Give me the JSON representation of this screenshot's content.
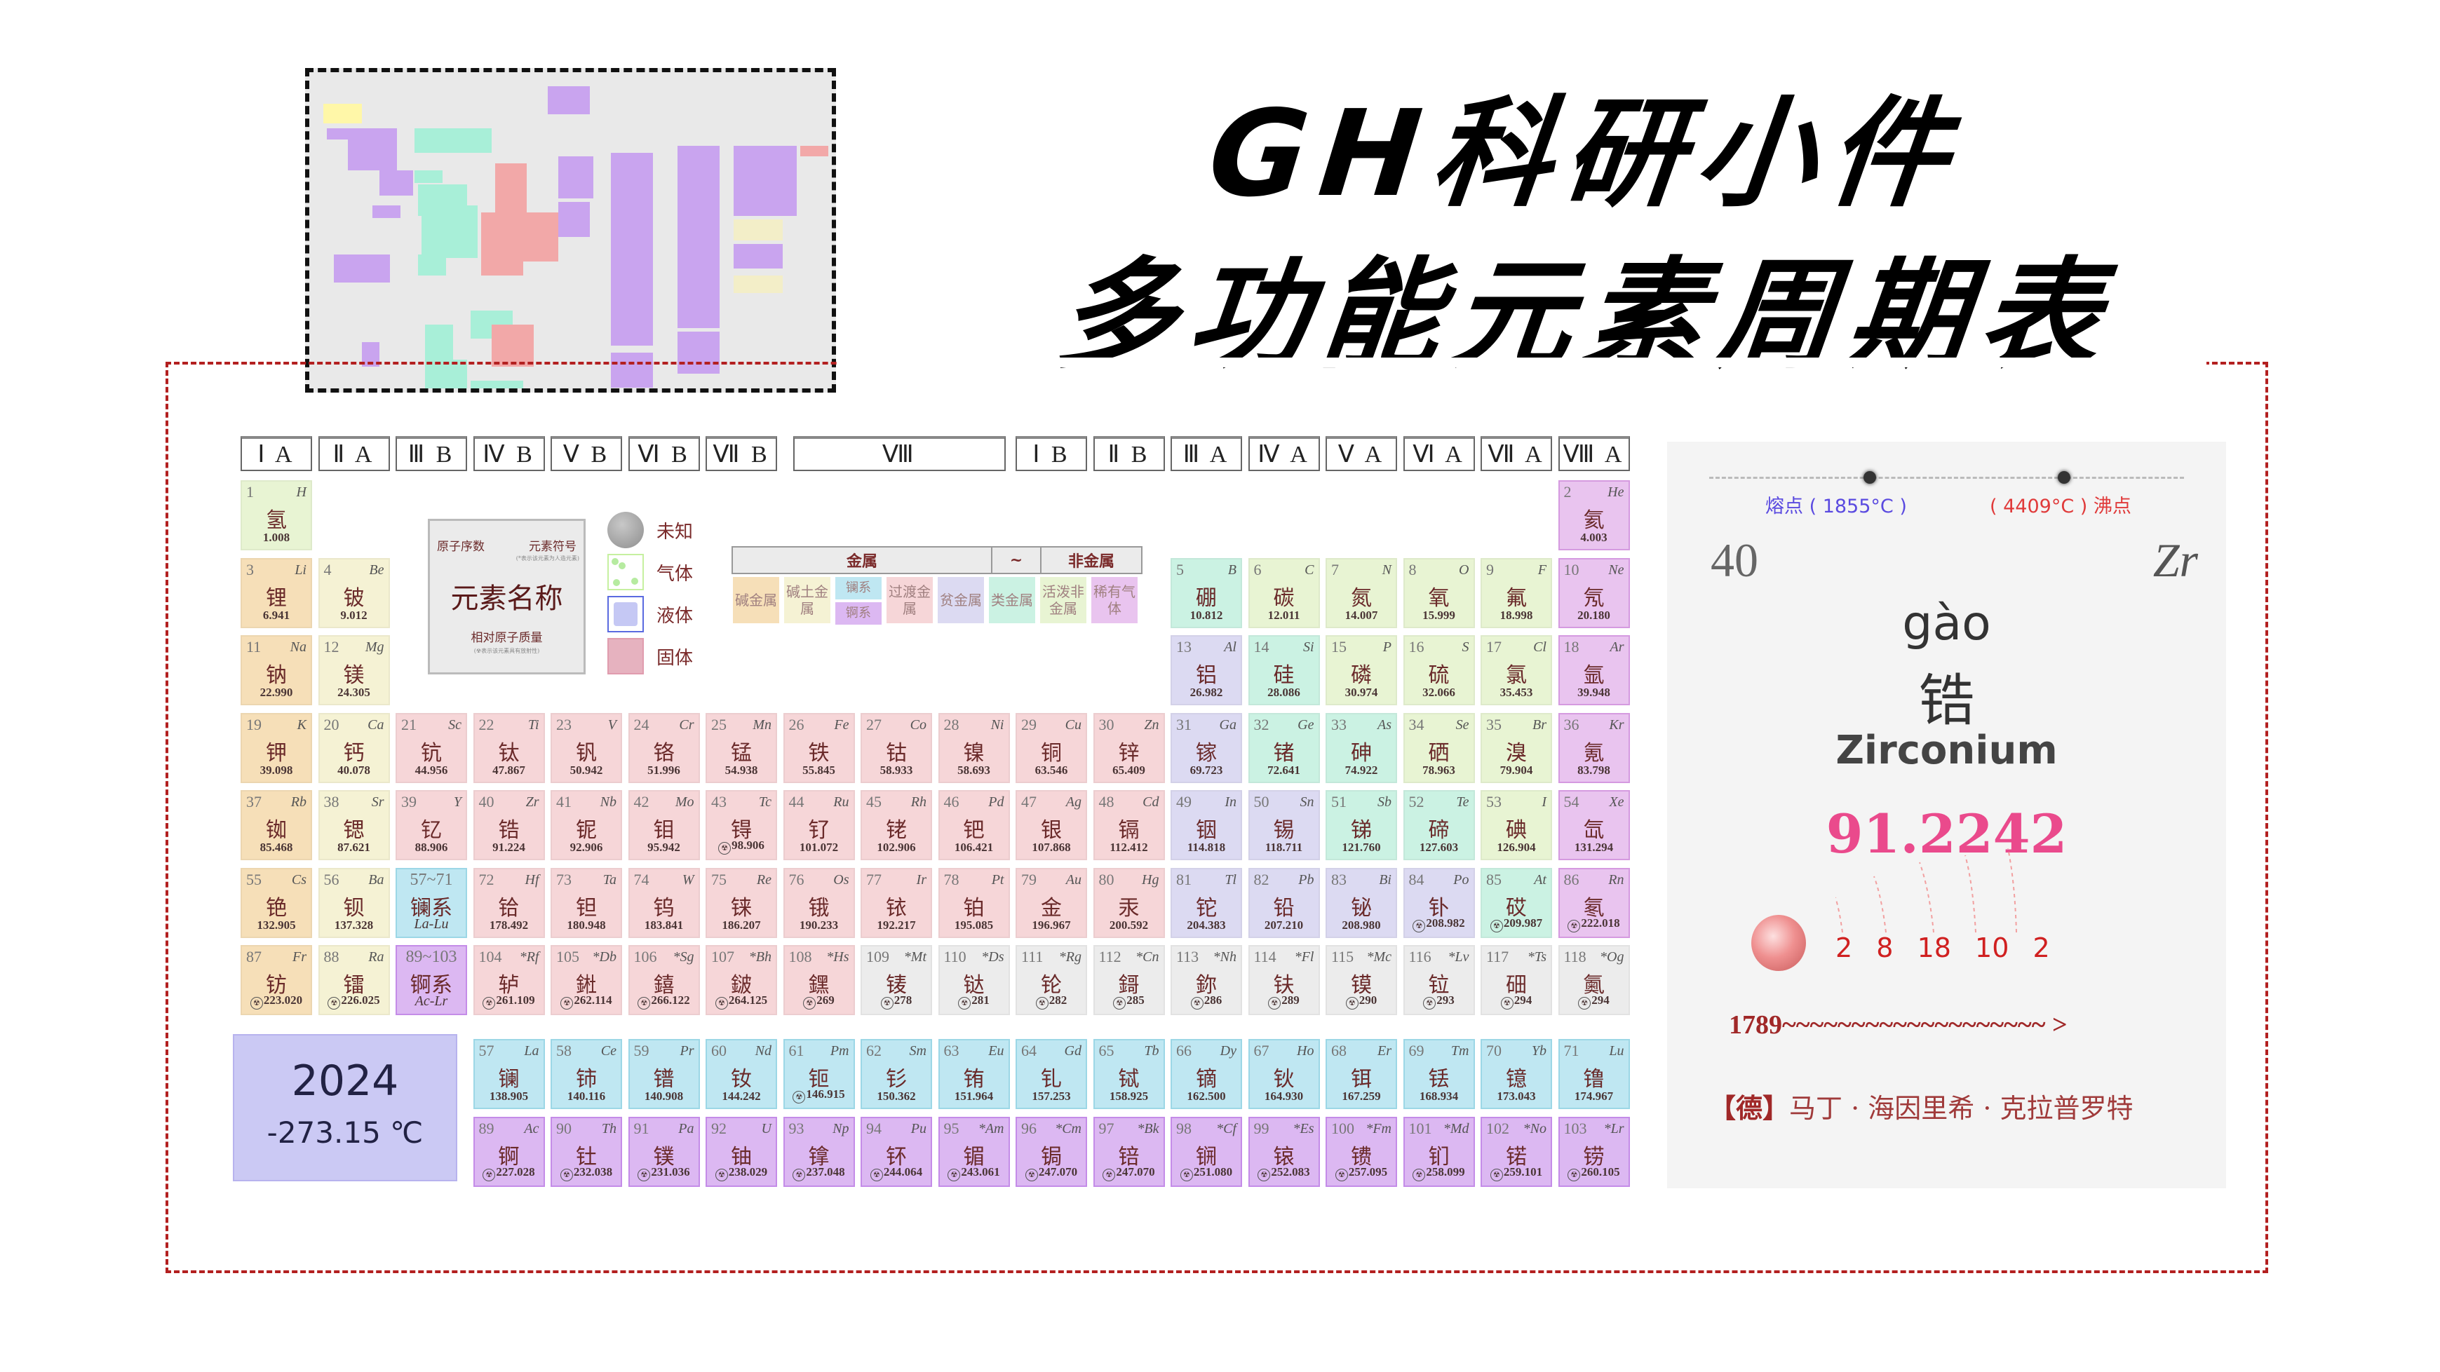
{
  "header": {
    "title_line1": "GH科研小件",
    "title_line2": "多功能元素周期表"
  },
  "groups": [
    "Ⅰ A",
    "Ⅱ A",
    "Ⅲ B",
    "Ⅳ B",
    "Ⅴ B",
    "Ⅵ B",
    "Ⅶ B",
    "Ⅷ",
    "Ⅰ B",
    "Ⅱ B",
    "Ⅲ A",
    "Ⅳ A",
    "Ⅴ A",
    "Ⅵ A",
    "Ⅶ A",
    "Ⅷ A"
  ],
  "legend": {
    "top_left": "原子序数",
    "top_right": "元素符号",
    "top_note": "(*表示该元素为人造元素)",
    "center": "元素名称",
    "bottom": "相对原子质量",
    "bottom_note": "(☢表示该元素具有放射性)",
    "states": [
      {
        "label": "未知",
        "icon": "unknown-state-icon"
      },
      {
        "label": "气体",
        "icon": "gas-state-icon"
      },
      {
        "label": "液体",
        "icon": "liquid-state-icon"
      },
      {
        "label": "固体",
        "icon": "solid-state-icon"
      }
    ],
    "category_heads": [
      "金属",
      "~",
      "非金属"
    ],
    "categories": [
      "碱金属",
      "碱土金属",
      "镧系",
      "锕系",
      "过渡金属",
      "贫金属",
      "类金属",
      "活泼非金属",
      "稀有气体"
    ]
  },
  "info": {
    "year": "2024",
    "temperature": "-273.15 ℃"
  },
  "detail": {
    "melting_point": "熔点 ( 1855°C )",
    "boiling_point": "( 4409°C ) 沸点",
    "number": "40",
    "symbol": "Zr",
    "pinyin": "gào",
    "chinese": "锆",
    "english": "Zirconium",
    "mass": "91.2242",
    "shells": [
      "2",
      "8",
      "18",
      "10",
      "2"
    ],
    "discovery": "1789~~~~~~~~~~~~~~~~~~~ >",
    "discoverer_country": "【德】",
    "discoverer": "马丁 · 海因里希 · 克拉普罗特"
  },
  "elements": [
    {
      "n": "1",
      "s": "H",
      "c": "氢",
      "m": "1.008",
      "cat": "nonmetal",
      "row": 1,
      "col": 1
    },
    {
      "n": "2",
      "s": "He",
      "c": "氦",
      "m": "4.003",
      "cat": "noble",
      "row": 1,
      "col": 18
    },
    {
      "n": "3",
      "s": "Li",
      "c": "锂",
      "m": "6.941",
      "cat": "alkali",
      "row": 2,
      "col": 1
    },
    {
      "n": "4",
      "s": "Be",
      "c": "铍",
      "m": "9.012",
      "cat": "alkearth",
      "row": 2,
      "col": 2
    },
    {
      "n": "5",
      "s": "B",
      "c": "硼",
      "m": "10.812",
      "cat": "metalloid",
      "row": 2,
      "col": 13
    },
    {
      "n": "6",
      "s": "C",
      "c": "碳",
      "m": "12.011",
      "cat": "nonmetal",
      "row": 2,
      "col": 14
    },
    {
      "n": "7",
      "s": "N",
      "c": "氮",
      "m": "14.007",
      "cat": "nonmetal",
      "row": 2,
      "col": 15
    },
    {
      "n": "8",
      "s": "O",
      "c": "氧",
      "m": "15.999",
      "cat": "nonmetal",
      "row": 2,
      "col": 16
    },
    {
      "n": "9",
      "s": "F",
      "c": "氟",
      "m": "18.998",
      "cat": "nonmetal",
      "row": 2,
      "col": 17
    },
    {
      "n": "10",
      "s": "Ne",
      "c": "氖",
      "m": "20.180",
      "cat": "noble",
      "row": 2,
      "col": 18
    },
    {
      "n": "11",
      "s": "Na",
      "c": "钠",
      "m": "22.990",
      "cat": "alkali",
      "row": 3,
      "col": 1
    },
    {
      "n": "12",
      "s": "Mg",
      "c": "镁",
      "m": "24.305",
      "cat": "alkearth",
      "row": 3,
      "col": 2
    },
    {
      "n": "13",
      "s": "Al",
      "c": "铝",
      "m": "26.982",
      "cat": "poor",
      "row": 3,
      "col": 13
    },
    {
      "n": "14",
      "s": "Si",
      "c": "硅",
      "m": "28.086",
      "cat": "metalloid",
      "row": 3,
      "col": 14
    },
    {
      "n": "15",
      "s": "P",
      "c": "磷",
      "m": "30.974",
      "cat": "nonmetal",
      "row": 3,
      "col": 15
    },
    {
      "n": "16",
      "s": "S",
      "c": "硫",
      "m": "32.066",
      "cat": "nonmetal",
      "row": 3,
      "col": 16
    },
    {
      "n": "17",
      "s": "Cl",
      "c": "氯",
      "m": "35.453",
      "cat": "nonmetal",
      "row": 3,
      "col": 17
    },
    {
      "n": "18",
      "s": "Ar",
      "c": "氩",
      "m": "39.948",
      "cat": "noble",
      "row": 3,
      "col": 18
    },
    {
      "n": "19",
      "s": "K",
      "c": "钾",
      "m": "39.098",
      "cat": "alkali",
      "row": 4,
      "col": 1
    },
    {
      "n": "20",
      "s": "Ca",
      "c": "钙",
      "m": "40.078",
      "cat": "alkearth",
      "row": 4,
      "col": 2
    },
    {
      "n": "21",
      "s": "Sc",
      "c": "钪",
      "m": "44.956",
      "cat": "trans",
      "row": 4,
      "col": 3
    },
    {
      "n": "22",
      "s": "Ti",
      "c": "钛",
      "m": "47.867",
      "cat": "trans",
      "row": 4,
      "col": 4
    },
    {
      "n": "23",
      "s": "V",
      "c": "钒",
      "m": "50.942",
      "cat": "trans",
      "row": 4,
      "col": 5
    },
    {
      "n": "24",
      "s": "Cr",
      "c": "铬",
      "m": "51.996",
      "cat": "trans",
      "row": 4,
      "col": 6
    },
    {
      "n": "25",
      "s": "Mn",
      "c": "锰",
      "m": "54.938",
      "cat": "trans",
      "row": 4,
      "col": 7
    },
    {
      "n": "26",
      "s": "Fe",
      "c": "铁",
      "m": "55.845",
      "cat": "trans",
      "row": 4,
      "col": 8
    },
    {
      "n": "27",
      "s": "Co",
      "c": "钴",
      "m": "58.933",
      "cat": "trans",
      "row": 4,
      "col": 9
    },
    {
      "n": "28",
      "s": "Ni",
      "c": "镍",
      "m": "58.693",
      "cat": "trans",
      "row": 4,
      "col": 10
    },
    {
      "n": "29",
      "s": "Cu",
      "c": "铜",
      "m": "63.546",
      "cat": "trans",
      "row": 4,
      "col": 11
    },
    {
      "n": "30",
      "s": "Zn",
      "c": "锌",
      "m": "65.409",
      "cat": "trans",
      "row": 4,
      "col": 12
    },
    {
      "n": "31",
      "s": "Ga",
      "c": "镓",
      "m": "69.723",
      "cat": "poor",
      "row": 4,
      "col": 13
    },
    {
      "n": "32",
      "s": "Ge",
      "c": "锗",
      "m": "72.641",
      "cat": "metalloid",
      "row": 4,
      "col": 14
    },
    {
      "n": "33",
      "s": "As",
      "c": "砷",
      "m": "74.922",
      "cat": "metalloid",
      "row": 4,
      "col": 15
    },
    {
      "n": "34",
      "s": "Se",
      "c": "硒",
      "m": "78.963",
      "cat": "nonmetal",
      "row": 4,
      "col": 16
    },
    {
      "n": "35",
      "s": "Br",
      "c": "溴",
      "m": "79.904",
      "cat": "nonmetal",
      "row": 4,
      "col": 17
    },
    {
      "n": "36",
      "s": "Kr",
      "c": "氪",
      "m": "83.798",
      "cat": "noble",
      "row": 4,
      "col": 18
    },
    {
      "n": "37",
      "s": "Rb",
      "c": "铷",
      "m": "85.468",
      "cat": "alkali",
      "row": 5,
      "col": 1
    },
    {
      "n": "38",
      "s": "Sr",
      "c": "锶",
      "m": "87.621",
      "cat": "alkearth",
      "row": 5,
      "col": 2
    },
    {
      "n": "39",
      "s": "Y",
      "c": "钇",
      "m": "88.906",
      "cat": "trans",
      "row": 5,
      "col": 3
    },
    {
      "n": "40",
      "s": "Zr",
      "c": "锆",
      "m": "91.224",
      "cat": "trans",
      "row": 5,
      "col": 4
    },
    {
      "n": "41",
      "s": "Nb",
      "c": "铌",
      "m": "92.906",
      "cat": "trans",
      "row": 5,
      "col": 5
    },
    {
      "n": "42",
      "s": "Mo",
      "c": "钼",
      "m": "95.942",
      "cat": "trans",
      "row": 5,
      "col": 6
    },
    {
      "n": "43",
      "s": "Tc",
      "c": "锝",
      "m": "98.906",
      "r": true,
      "cat": "trans",
      "row": 5,
      "col": 7
    },
    {
      "n": "44",
      "s": "Ru",
      "c": "钌",
      "m": "101.072",
      "cat": "trans",
      "row": 5,
      "col": 8
    },
    {
      "n": "45",
      "s": "Rh",
      "c": "铑",
      "m": "102.906",
      "cat": "trans",
      "row": 5,
      "col": 9
    },
    {
      "n": "46",
      "s": "Pd",
      "c": "钯",
      "m": "106.421",
      "cat": "trans",
      "row": 5,
      "col": 10
    },
    {
      "n": "47",
      "s": "Ag",
      "c": "银",
      "m": "107.868",
      "cat": "trans",
      "row": 5,
      "col": 11
    },
    {
      "n": "48",
      "s": "Cd",
      "c": "镉",
      "m": "112.412",
      "cat": "trans",
      "row": 5,
      "col": 12
    },
    {
      "n": "49",
      "s": "In",
      "c": "铟",
      "m": "114.818",
      "cat": "poor",
      "row": 5,
      "col": 13
    },
    {
      "n": "50",
      "s": "Sn",
      "c": "锡",
      "m": "118.711",
      "cat": "poor",
      "row": 5,
      "col": 14
    },
    {
      "n": "51",
      "s": "Sb",
      "c": "锑",
      "m": "121.760",
      "cat": "metalloid",
      "row": 5,
      "col": 15
    },
    {
      "n": "52",
      "s": "Te",
      "c": "碲",
      "m": "127.603",
      "cat": "metalloid",
      "row": 5,
      "col": 16
    },
    {
      "n": "53",
      "s": "I",
      "c": "碘",
      "m": "126.904",
      "cat": "nonmetal",
      "row": 5,
      "col": 17
    },
    {
      "n": "54",
      "s": "Xe",
      "c": "氙",
      "m": "131.294",
      "cat": "noble",
      "row": 5,
      "col": 18
    },
    {
      "n": "55",
      "s": "Cs",
      "c": "铯",
      "m": "132.905",
      "cat": "alkali",
      "row": 6,
      "col": 1
    },
    {
      "n": "56",
      "s": "Ba",
      "c": "钡",
      "m": "137.328",
      "cat": "alkearth",
      "row": 6,
      "col": 2
    },
    {
      "n": "57~71",
      "s": "",
      "c": "镧系",
      "m": "La-Lu",
      "it": true,
      "cat": "lanth",
      "row": 6,
      "col": 3
    },
    {
      "n": "72",
      "s": "Hf",
      "c": "铪",
      "m": "178.492",
      "cat": "trans",
      "row": 6,
      "col": 4
    },
    {
      "n": "73",
      "s": "Ta",
      "c": "钽",
      "m": "180.948",
      "cat": "trans",
      "row": 6,
      "col": 5
    },
    {
      "n": "74",
      "s": "W",
      "c": "钨",
      "m": "183.841",
      "cat": "trans",
      "row": 6,
      "col": 6
    },
    {
      "n": "75",
      "s": "Re",
      "c": "铼",
      "m": "186.207",
      "cat": "trans",
      "row": 6,
      "col": 7
    },
    {
      "n": "76",
      "s": "Os",
      "c": "锇",
      "m": "190.233",
      "cat": "trans",
      "row": 6,
      "col": 8
    },
    {
      "n": "77",
      "s": "Ir",
      "c": "铱",
      "m": "192.217",
      "cat": "trans",
      "row": 6,
      "col": 9
    },
    {
      "n": "78",
      "s": "Pt",
      "c": "铂",
      "m": "195.085",
      "cat": "trans",
      "row": 6,
      "col": 10
    },
    {
      "n": "79",
      "s": "Au",
      "c": "金",
      "m": "196.967",
      "cat": "trans",
      "row": 6,
      "col": 11
    },
    {
      "n": "80",
      "s": "Hg",
      "c": "汞",
      "m": "200.592",
      "cat": "trans",
      "row": 6,
      "col": 12
    },
    {
      "n": "81",
      "s": "Tl",
      "c": "铊",
      "m": "204.383",
      "cat": "poor",
      "row": 6,
      "col": 13
    },
    {
      "n": "82",
      "s": "Pb",
      "c": "铅",
      "m": "207.210",
      "cat": "poor",
      "row": 6,
      "col": 14
    },
    {
      "n": "83",
      "s": "Bi",
      "c": "铋",
      "m": "208.980",
      "cat": "poor",
      "row": 6,
      "col": 15
    },
    {
      "n": "84",
      "s": "Po",
      "c": "钋",
      "m": "208.982",
      "r": true,
      "cat": "poor",
      "row": 6,
      "col": 16
    },
    {
      "n": "85",
      "s": "At",
      "c": "砹",
      "m": "209.987",
      "r": true,
      "cat": "metalloid",
      "row": 6,
      "col": 17
    },
    {
      "n": "86",
      "s": "Rn",
      "c": "氡",
      "m": "222.018",
      "r": true,
      "cat": "noble",
      "row": 6,
      "col": 18
    },
    {
      "n": "87",
      "s": "Fr",
      "c": "钫",
      "m": "223.020",
      "r": true,
      "cat": "alkali",
      "row": 7,
      "col": 1
    },
    {
      "n": "88",
      "s": "Ra",
      "c": "镭",
      "m": "226.025",
      "r": true,
      "cat": "alkearth",
      "row": 7,
      "col": 2
    },
    {
      "n": "89~103",
      "s": "",
      "c": "锕系",
      "m": "Ac-Lr",
      "it": true,
      "cat": "actin",
      "row": 7,
      "col": 3
    },
    {
      "n": "104",
      "s": "*Rf",
      "c": "轳",
      "m": "261.109",
      "r": true,
      "cat": "trans",
      "row": 7,
      "col": 4
    },
    {
      "n": "105",
      "s": "*Db",
      "c": "𨧀",
      "m": "262.114",
      "r": true,
      "cat": "trans",
      "row": 7,
      "col": 5
    },
    {
      "n": "106",
      "s": "*Sg",
      "c": "𨭎",
      "m": "266.122",
      "r": true,
      "cat": "trans",
      "row": 7,
      "col": 6
    },
    {
      "n": "107",
      "s": "*Bh",
      "c": "𨨏",
      "m": "264.125",
      "r": true,
      "cat": "trans",
      "row": 7,
      "col": 7
    },
    {
      "n": "108",
      "s": "*Hs",
      "c": "𨭆",
      "m": "269",
      "r": true,
      "cat": "trans",
      "row": 7,
      "col": 8
    },
    {
      "n": "109",
      "s": "*Mt",
      "c": "鿏",
      "m": "278",
      "r": true,
      "cat": "unknown",
      "row": 7,
      "col": 9
    },
    {
      "n": "110",
      "s": "*Ds",
      "c": "𫟼",
      "m": "281",
      "r": true,
      "cat": "unknown",
      "row": 7,
      "col": 10
    },
    {
      "n": "111",
      "s": "*Rg",
      "c": "𬬭",
      "m": "282",
      "r": true,
      "cat": "unknown",
      "row": 7,
      "col": 11
    },
    {
      "n": "112",
      "s": "*Cn",
      "c": "鎶",
      "m": "285",
      "r": true,
      "cat": "unknown",
      "row": 7,
      "col": 12
    },
    {
      "n": "113",
      "s": "*Nh",
      "c": "鉨",
      "m": "286",
      "r": true,
      "cat": "unknown",
      "row": 7,
      "col": 13
    },
    {
      "n": "114",
      "s": "*Fl",
      "c": "𫓧",
      "m": "289",
      "r": true,
      "cat": "unknown",
      "row": 7,
      "col": 14
    },
    {
      "n": "115",
      "s": "*Mc",
      "c": "镆",
      "m": "290",
      "r": true,
      "cat": "unknown",
      "row": 7,
      "col": 15
    },
    {
      "n": "116",
      "s": "*Lv",
      "c": "𫟷",
      "m": "293",
      "r": true,
      "cat": "unknown",
      "row": 7,
      "col": 16
    },
    {
      "n": "117",
      "s": "*Ts",
      "c": "鿬",
      "m": "294",
      "r": true,
      "cat": "unknown",
      "row": 7,
      "col": 17
    },
    {
      "n": "118",
      "s": "*Og",
      "c": "鿫",
      "m": "294",
      "r": true,
      "cat": "unknown",
      "row": 7,
      "col": 18
    },
    {
      "n": "57",
      "s": "La",
      "c": "镧",
      "m": "138.905",
      "cat": "lanth",
      "row": 9,
      "col": 4
    },
    {
      "n": "58",
      "s": "Ce",
      "c": "铈",
      "m": "140.116",
      "cat": "lanth",
      "row": 9,
      "col": 5
    },
    {
      "n": "59",
      "s": "Pr",
      "c": "镨",
      "m": "140.908",
      "cat": "lanth",
      "row": 9,
      "col": 6
    },
    {
      "n": "60",
      "s": "Nd",
      "c": "钕",
      "m": "144.242",
      "cat": "lanth",
      "row": 9,
      "col": 7
    },
    {
      "n": "61",
      "s": "Pm",
      "c": "钷",
      "m": "146.915",
      "r": true,
      "cat": "lanth",
      "row": 9,
      "col": 8
    },
    {
      "n": "62",
      "s": "Sm",
      "c": "钐",
      "m": "150.362",
      "cat": "lanth",
      "row": 9,
      "col": 9
    },
    {
      "n": "63",
      "s": "Eu",
      "c": "铕",
      "m": "151.964",
      "cat": "lanth",
      "row": 9,
      "col": 10
    },
    {
      "n": "64",
      "s": "Gd",
      "c": "钆",
      "m": "157.253",
      "cat": "lanth",
      "row": 9,
      "col": 11
    },
    {
      "n": "65",
      "s": "Tb",
      "c": "铽",
      "m": "158.925",
      "cat": "lanth",
      "row": 9,
      "col": 12
    },
    {
      "n": "66",
      "s": "Dy",
      "c": "镝",
      "m": "162.500",
      "cat": "lanth",
      "row": 9,
      "col": 13
    },
    {
      "n": "67",
      "s": "Ho",
      "c": "钬",
      "m": "164.930",
      "cat": "lanth",
      "row": 9,
      "col": 14
    },
    {
      "n": "68",
      "s": "Er",
      "c": "铒",
      "m": "167.259",
      "cat": "lanth",
      "row": 9,
      "col": 15
    },
    {
      "n": "69",
      "s": "Tm",
      "c": "铥",
      "m": "168.934",
      "cat": "lanth",
      "row": 9,
      "col": 16
    },
    {
      "n": "70",
      "s": "Yb",
      "c": "镱",
      "m": "173.043",
      "cat": "lanth",
      "row": 9,
      "col": 17
    },
    {
      "n": "71",
      "s": "Lu",
      "c": "镥",
      "m": "174.967",
      "cat": "lanth",
      "row": 9,
      "col": 18
    },
    {
      "n": "89",
      "s": "Ac",
      "c": "锕",
      "m": "227.028",
      "r": true,
      "cat": "actin",
      "row": 10,
      "col": 4
    },
    {
      "n": "90",
      "s": "Th",
      "c": "钍",
      "m": "232.038",
      "r": true,
      "cat": "actin",
      "row": 10,
      "col": 5
    },
    {
      "n": "91",
      "s": "Pa",
      "c": "镤",
      "m": "231.036",
      "r": true,
      "cat": "actin",
      "row": 10,
      "col": 6
    },
    {
      "n": "92",
      "s": "U",
      "c": "铀",
      "m": "238.029",
      "r": true,
      "cat": "actin",
      "row": 10,
      "col": 7
    },
    {
      "n": "93",
      "s": "Np",
      "c": "镎",
      "m": "237.048",
      "r": true,
      "cat": "actin",
      "row": 10,
      "col": 8
    },
    {
      "n": "94",
      "s": "Pu",
      "c": "钚",
      "m": "244.064",
      "r": true,
      "cat": "actin",
      "row": 10,
      "col": 9
    },
    {
      "n": "95",
      "s": "*Am",
      "c": "镅",
      "m": "243.061",
      "r": true,
      "cat": "actin",
      "row": 10,
      "col": 10
    },
    {
      "n": "96",
      "s": "*Cm",
      "c": "锔",
      "m": "247.070",
      "r": true,
      "cat": "actin",
      "row": 10,
      "col": 11
    },
    {
      "n": "97",
      "s": "*Bk",
      "c": "锫",
      "m": "247.070",
      "r": true,
      "cat": "actin",
      "row": 10,
      "col": 12
    },
    {
      "n": "98",
      "s": "*Cf",
      "c": "锎",
      "m": "251.080",
      "r": true,
      "cat": "actin",
      "row": 10,
      "col": 13
    },
    {
      "n": "99",
      "s": "*Es",
      "c": "锿",
      "m": "252.083",
      "r": true,
      "cat": "actin",
      "row": 10,
      "col": 14
    },
    {
      "n": "100",
      "s": "*Fm",
      "c": "镄",
      "m": "257.095",
      "r": true,
      "cat": "actin",
      "row": 10,
      "col": 15
    },
    {
      "n": "101",
      "s": "*Md",
      "c": "钔",
      "m": "258.099",
      "r": true,
      "cat": "actin",
      "row": 10,
      "col": 16
    },
    {
      "n": "102",
      "s": "*No",
      "c": "锘",
      "m": "259.101",
      "r": true,
      "cat": "actin",
      "row": 10,
      "col": 17
    },
    {
      "n": "103",
      "s": "*Lr",
      "c": "铹",
      "m": "260.105",
      "r": true,
      "cat": "actin",
      "row": 10,
      "col": 18
    }
  ]
}
